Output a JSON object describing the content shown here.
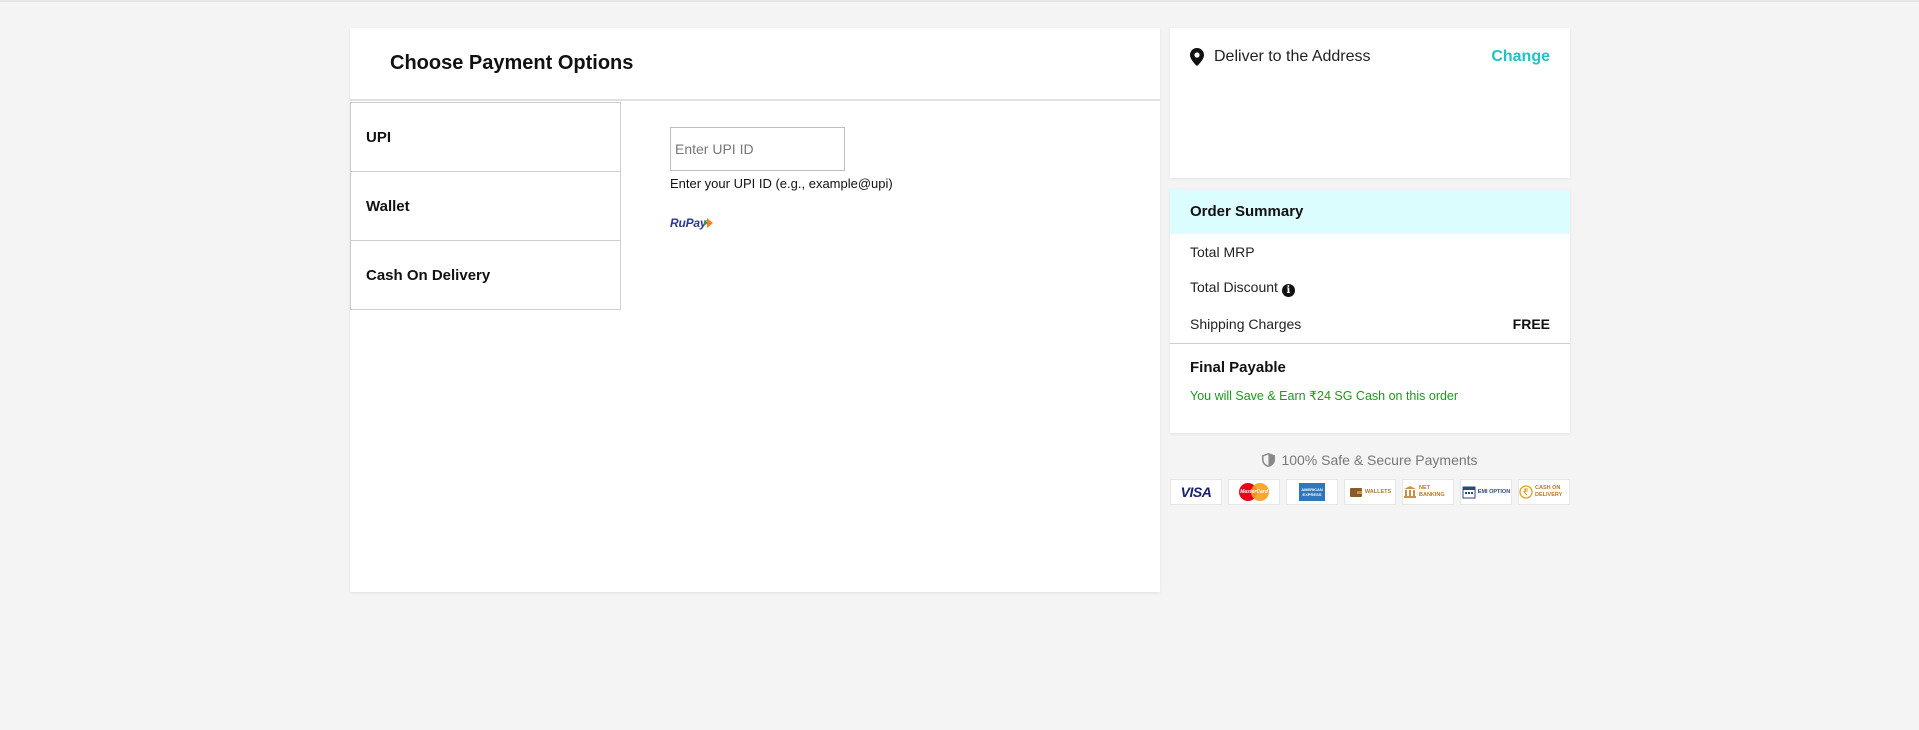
{
  "payment": {
    "title": "Choose Payment Options",
    "tabs": [
      {
        "label": "UPI"
      },
      {
        "label": "Wallet"
      },
      {
        "label": "Cash On Delivery"
      }
    ],
    "upi": {
      "placeholder": "Enter UPI ID",
      "value": "",
      "helper": "Enter your UPI ID (e.g., example@upi)",
      "logo_text": "RuPay"
    }
  },
  "address": {
    "label": "Deliver to the Address",
    "change_label": "Change"
  },
  "summary": {
    "title": "Order Summary",
    "rows": [
      {
        "label": "Total MRP",
        "value": ""
      },
      {
        "label": "Total Discount",
        "value": ""
      },
      {
        "label": "Shipping Charges",
        "value": "FREE"
      }
    ],
    "final_label": "Final Payable",
    "savings_text": "You will Save & Earn ₹24 SG Cash on this order"
  },
  "secure": {
    "text": "100% Safe & Secure Payments"
  },
  "badges": {
    "visa": "VISA",
    "mastercard": "MasterCard",
    "amex": "AMERICAN EXPRESS",
    "wallets": "WALLETS",
    "netbanking": "NET BANKING",
    "emi": "EMI OPTION",
    "cod": "CASH ON DELIVERY"
  },
  "colors": {
    "accent": "#1fc4c4",
    "summary_header_bg": "#dcfdfd",
    "savings_green": "#1a9a1a",
    "page_bg": "#f4f4f4"
  },
  "icons": [
    "location-pin-icon",
    "info-icon",
    "shield-icon",
    "wallet-icon",
    "bank-icon",
    "calendar-icon",
    "rupee-icon"
  ]
}
